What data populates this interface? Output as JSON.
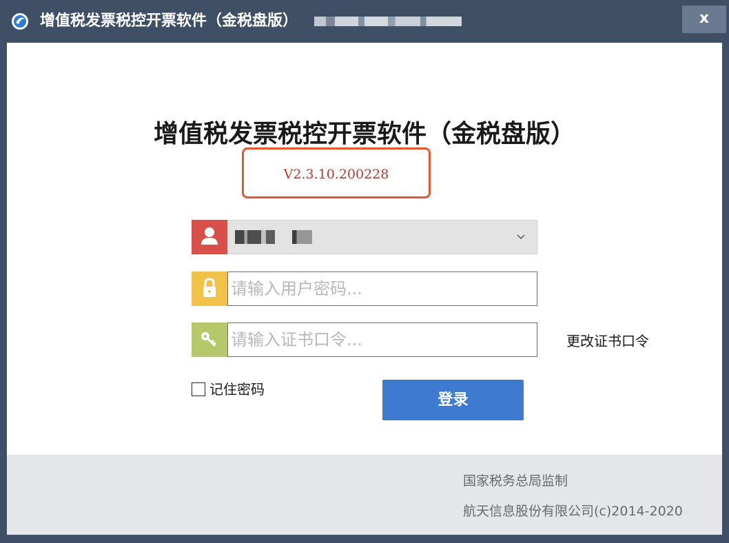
{
  "window": {
    "title": "增值税发票税控开票软件（金税盘版）",
    "close_label": "x"
  },
  "main": {
    "title": "增值税发票税控开票软件（金税盘版）",
    "version": "V2.3.10.200228"
  },
  "form": {
    "password_placeholder": "请输入用户密码...",
    "certificate_placeholder": "请输入证书口令...",
    "change_cert_link": "更改证书口令",
    "remember_label": "记住密码",
    "login_label": "登录"
  },
  "footer": {
    "line1": "国家税务总局监制",
    "line2": "航天信息股份有限公司(c)2014-2020"
  },
  "colors": {
    "titlebar": "#3f5066",
    "version_highlight": "#e4572e",
    "user_icon_bg": "#d8504a",
    "lock_icon_bg": "#f0c24a",
    "key_icon_bg": "#b7c86a",
    "login_button": "#3e7bd0"
  },
  "icons": [
    "app-logo-icon",
    "user-icon",
    "lock-icon",
    "key-icon",
    "chevron-down-icon",
    "close-icon"
  ]
}
